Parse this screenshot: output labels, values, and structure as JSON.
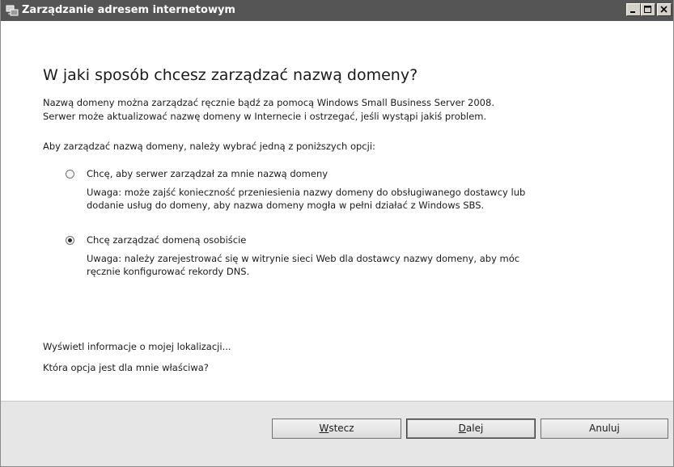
{
  "window": {
    "title": "Zarządzanie adresem internetowym",
    "controls": [
      "minimize-icon",
      "maximize-icon",
      "close-icon"
    ]
  },
  "main": {
    "heading": "W jaki sposób chcesz zarządzać nazwą domeny?",
    "intro_line1": "Nazwą domeny można zarządzać ręcznie bądź za pomocą Windows Small Business Server 2008.",
    "intro_line2": "Serwer może aktualizować nazwę domeny w Internecie i ostrzegać, jeśli wystąpi jakiś problem.",
    "choose_prompt": "Aby zarządzać nazwą domeny, należy wybrać jedną z poniższych opcji:",
    "options": [
      {
        "label": "Chcę, aby serwer zarządzał za mnie nazwą domeny",
        "note_line1": "Uwaga: może zajść konieczność przeniesienia nazwy domeny do obsługiwanego dostawcy lub",
        "note_line2": "dodanie usług do domeny, aby nazwa domeny mogła w pełni działać z Windows SBS.",
        "selected": false
      },
      {
        "label": "Chcę zarządzać domeną osobiście",
        "note_line1": "Uwaga: należy zarejestrować się w witrynie sieci Web dla dostawcy nazwy domeny, aby móc",
        "note_line2": "ręcznie konfigurować rekordy DNS.",
        "selected": true
      }
    ],
    "link_location": "Wyświetl informacje o mojej lokalizacji...",
    "link_which_option": "Która opcja jest dla mnie właściwa?"
  },
  "footer": {
    "back_accel": "W",
    "back_rest": "stecz",
    "next_accel": "D",
    "next_rest": "alej",
    "cancel_label": "Anuluj"
  }
}
